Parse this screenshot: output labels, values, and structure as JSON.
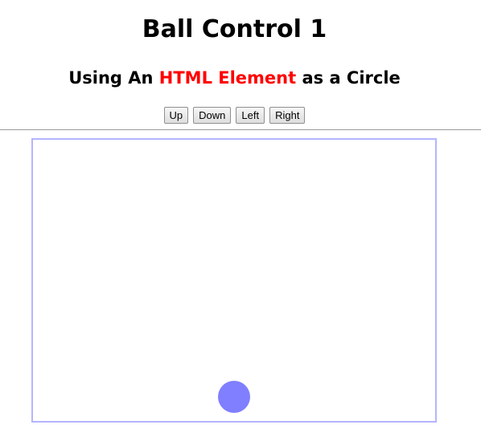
{
  "header": {
    "title": "Ball Control 1",
    "subtitle": {
      "prefix": "Using An ",
      "highlight": "HTML Element",
      "suffix": " as a Circle",
      "highlight_color": "#ff0000"
    }
  },
  "controls": {
    "up_label": "Up",
    "down_label": "Down",
    "left_label": "Left",
    "right_label": "Right"
  },
  "play_area": {
    "border_color": "#b4b4ff",
    "ball": {
      "color": "#7f7fff",
      "shape": "circle"
    }
  }
}
